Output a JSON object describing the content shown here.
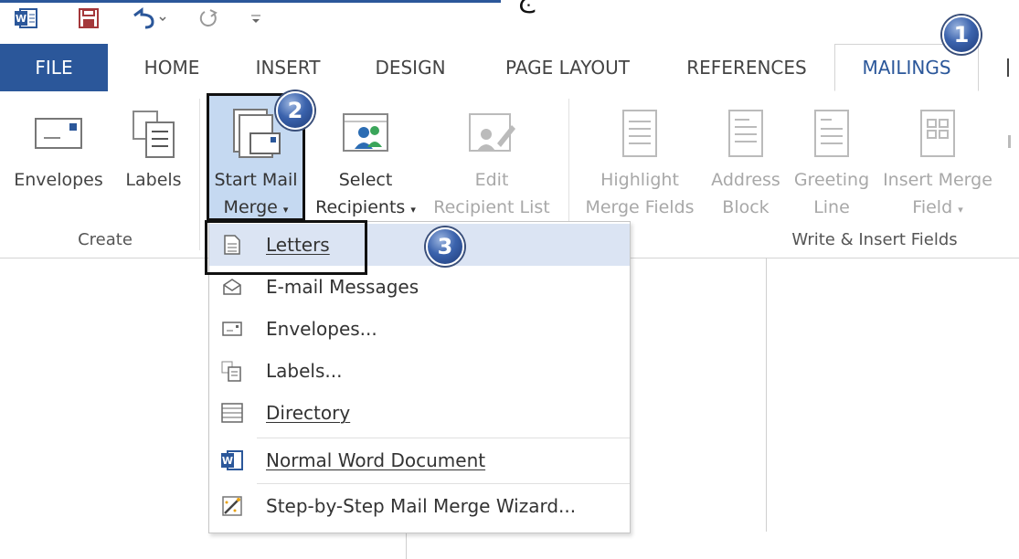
{
  "title_text": "ج",
  "tabs": {
    "file": "FILE",
    "home": "HOME",
    "insert": "INSERT",
    "design": "DESIGN",
    "page_layout": "PAGE LAYOUT",
    "references": "REFERENCES",
    "mailings": "MAILINGS"
  },
  "ribbon": {
    "envelopes": "Envelopes",
    "labels": "Labels",
    "start_mail_merge_1": "Start Mail",
    "start_mail_merge_2": "Merge",
    "select_recipients_1": "Select",
    "select_recipients_2": "Recipients",
    "edit_list_1": "Edit",
    "edit_list_2": "Recipient List",
    "highlight_1": "Highlight",
    "highlight_2": "Merge Fields",
    "address_1": "Address",
    "address_2": "Block",
    "greeting_1": "Greeting",
    "greeting_2": "Line",
    "insert_field_1": "Insert Merge",
    "insert_field_2": "Field",
    "group_create": "Create",
    "group_write": "Write & Insert Fields"
  },
  "badges": {
    "b1": "1",
    "b2": "2",
    "b3": "3"
  },
  "menu": {
    "letters": "Letters",
    "email": "E-mail Messages",
    "envelopes": "Envelopes...",
    "labels": "Labels...",
    "directory": "Directory",
    "normal_doc": "Normal Word Document",
    "wizard": "Step-by-Step Mail Merge Wizard..."
  },
  "colors": {
    "accent": "#2b579a",
    "hover": "#dbe4f3",
    "pressed": "#c5d9f1"
  }
}
